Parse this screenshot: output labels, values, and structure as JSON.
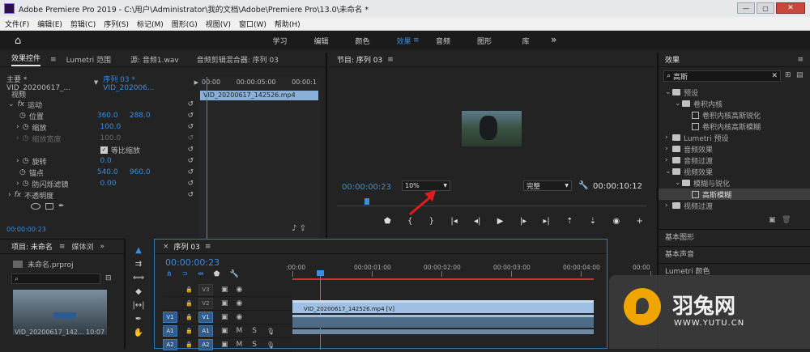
{
  "window": {
    "title": "Adobe Premiere Pro 2019 - C:\\用户\\Administrator\\我的文档\\Adobe\\Premiere Pro\\13.0\\未命名 *"
  },
  "menu": [
    "文件(F)",
    "编辑(E)",
    "剪辑(C)",
    "序列(S)",
    "标记(M)",
    "图形(G)",
    "视图(V)",
    "窗口(W)",
    "帮助(H)"
  ],
  "workspaces": [
    "学习",
    "编辑",
    "颜色",
    "效果",
    "音频",
    "图形",
    "库"
  ],
  "effect_controls": {
    "tabs": [
      "效果控件",
      "Lumetri 范围",
      "源: 音频1.wav",
      "音频剪辑混合器: 序列 03"
    ],
    "master": "主要 * VID_20200617_...",
    "sequence": "序列 03 * VID_202006...",
    "ruler": [
      "00:00",
      "00:00:05:00",
      "00:00:1"
    ],
    "clip": "VID_20200617_142526.mp4",
    "video_label": "视频",
    "motion": "运动",
    "position": {
      "label": "位置",
      "x": "360.0",
      "y": "288.0"
    },
    "scale": {
      "label": "缩放",
      "value": "100.0"
    },
    "scale_width": {
      "label": "缩放宽度",
      "value": "100.0"
    },
    "uniform": "等比缩放",
    "rotation": {
      "label": "旋转",
      "value": "0.0"
    },
    "anchor": {
      "label": "锚点",
      "x": "540.0",
      "y": "960.0"
    },
    "antiflicker": {
      "label": "防闪烁滤镜",
      "value": "0.00"
    },
    "opacity": "不透明度",
    "timecode": "00:00:00:23"
  },
  "program": {
    "title": "节目: 序列 03",
    "timecode": "00:00:00:23",
    "zoom": "10%",
    "quality": "完整",
    "duration": "00:00:10:12"
  },
  "project": {
    "tabs": [
      "项目: 未命名",
      "媒体浏"
    ],
    "file": "未命名.prproj",
    "thumb_name": "VID_20200617_142...",
    "thumb_dur": "10:07"
  },
  "timeline": {
    "tab": "序列 03",
    "timecode": "00:00:00:23",
    "ruler": [
      ":00:00",
      "00:00:01:00",
      "00:00:02:00",
      "00:00:03:00",
      "00:00:04:00",
      "00:00"
    ],
    "tracks": [
      {
        "name": "V3"
      },
      {
        "name": "V2"
      },
      {
        "name": "V1",
        "src": "V1"
      },
      {
        "name": "A1",
        "src": "A1"
      },
      {
        "name": "A2",
        "src": "A2"
      }
    ],
    "video_clip": "VID_20200617_142526.mp4 [V]"
  },
  "effects": {
    "title": "效果",
    "search": "高斯",
    "items": [
      {
        "label": "预设",
        "indent": 0,
        "type": "folder"
      },
      {
        "label": "卷积内核",
        "indent": 1,
        "type": "folder"
      },
      {
        "label": "卷积内核高斯锐化",
        "indent": 2,
        "type": "preset"
      },
      {
        "label": "卷积内核高斯模糊",
        "indent": 2,
        "type": "preset"
      },
      {
        "label": "Lumetri 预设",
        "indent": 0,
        "type": "folder"
      },
      {
        "label": "音频效果",
        "indent": 0,
        "type": "folder"
      },
      {
        "label": "音频过渡",
        "indent": 0,
        "type": "folder"
      },
      {
        "label": "视频效果",
        "indent": 0,
        "type": "folder"
      },
      {
        "label": "模糊与锐化",
        "indent": 1,
        "type": "folder"
      },
      {
        "label": "高斯模糊",
        "indent": 2,
        "type": "preset",
        "selected": true
      },
      {
        "label": "视频过渡",
        "indent": 0,
        "type": "folder"
      }
    ],
    "bottom": [
      "基本图形",
      "基本声音",
      "Lumetri 颜色"
    ]
  },
  "watermark": {
    "name": "羽兔网",
    "url": "WWW.YUTU.CN"
  },
  "colors": {
    "accent": "#2d8ceb",
    "playhead": "#3b8ddf",
    "arrow": "#e01d1d"
  }
}
